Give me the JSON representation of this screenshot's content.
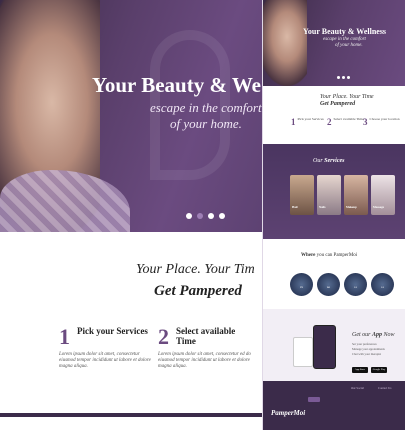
{
  "hero": {
    "title": "Your Beauty & We",
    "subtitle_line1": "escape in the comfort",
    "subtitle_line2": "of your home."
  },
  "pamper": {
    "line1": "Your Place. Your Tim",
    "line2": "Get Pampered",
    "steps": [
      {
        "num": "1",
        "title": "Pick your Services",
        "body": "Lorem ipsum dolor sit amet, consectetur eiusmod tempor incididunt ut labore et dolore magna aliqua."
      },
      {
        "num": "2",
        "title": "Select available Time",
        "body": "Lorem ipsum dolor sit amet, consectetur ed do eiusmod tempor incididunt ut labore et dolore magna aliqua."
      }
    ]
  },
  "mobile": {
    "hero_title": "Your Beauty & Wellness",
    "hero_sub1": "escape in the comfort",
    "hero_sub2": "of your home.",
    "pamper_line1": "Your Place. Your Time",
    "pamper_line2": "Get Pampered",
    "steps": [
      {
        "num": "1",
        "title": "Pick your Services"
      },
      {
        "num": "2",
        "title": "Select available Time"
      },
      {
        "num": "3",
        "title": "Choose your location"
      }
    ],
    "services_title_a": "Our ",
    "services_title_b": "Services",
    "services": [
      "Hair",
      "Nails",
      "Makeup",
      "Massage"
    ],
    "where_a": "Where ",
    "where_b": "you can PamperMoi",
    "cities": [
      "NY",
      "WA",
      "CA",
      "CA"
    ],
    "app_a": "Get our ",
    "app_b": "App",
    "app_c": " Now",
    "app_features": [
      "Set your preferences",
      "Manage your appointments",
      "Chat with your therapist"
    ],
    "store1": "App Store",
    "store2": "Google Play",
    "footer_logo": "PamperMoi",
    "footer_cols": [
      "Our Social",
      "Contact Us"
    ]
  }
}
